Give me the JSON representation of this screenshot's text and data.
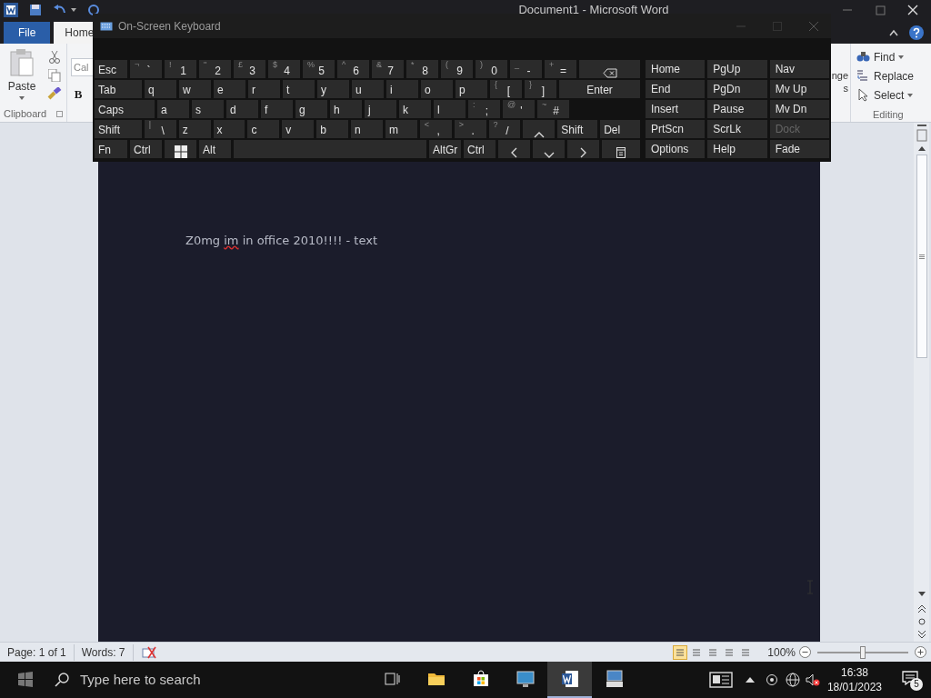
{
  "word_window": {
    "title": "Document1 - Microsoft Word",
    "ribbon_tabs": [
      {
        "label": "File",
        "kind": "file",
        "selected": false
      },
      {
        "label": "Home",
        "kind": "tab",
        "selected": true
      }
    ],
    "clipboard": {
      "paste": "Paste",
      "group": "Clipboard"
    },
    "font": {
      "font_box": "Cal",
      "bold": "B"
    },
    "styles_partial": [
      "nge",
      "s"
    ],
    "editing": {
      "items": [
        {
          "label": "Find",
          "dropdown": true,
          "kind": "find"
        },
        {
          "label": "Replace",
          "dropdown": false,
          "kind": "replace"
        },
        {
          "label": "Select",
          "dropdown": true,
          "kind": "select"
        }
      ],
      "group": "Editing"
    },
    "document": [
      {
        "text": "Z0mg",
        "misspelled": false
      },
      {
        "text": "im",
        "misspelled": true
      },
      {
        "text": "in office 2010!!!! - text",
        "misspelled": false
      }
    ],
    "status_bar": {
      "page": "Page: 1 of 1",
      "words": "Words: 7",
      "views": [
        {
          "selected": true
        },
        {
          "selected": false
        },
        {
          "selected": false
        },
        {
          "selected": false
        },
        {
          "selected": false
        }
      ],
      "zoom": "100%",
      "zoom_slider": {
        "level": 0.5
      }
    }
  },
  "keyboard": {
    "title": "On-Screen Keyboard",
    "rows": [
      [
        {
          "label": "Esc",
          "kind": "mod"
        },
        {
          "label": "`",
          "shift": "¬",
          "kind": "key"
        },
        {
          "label": "1",
          "shift": "!",
          "kind": "key"
        },
        {
          "label": "2",
          "shift": "\"",
          "kind": "key"
        },
        {
          "label": "3",
          "shift": "£",
          "kind": "key"
        },
        {
          "label": "4",
          "shift": "$",
          "kind": "key"
        },
        {
          "label": "5",
          "shift": "%",
          "kind": "key"
        },
        {
          "label": "6",
          "shift": "^",
          "kind": "key"
        },
        {
          "label": "7",
          "shift": "&",
          "kind": "key"
        },
        {
          "label": "8",
          "shift": "*",
          "kind": "key"
        },
        {
          "label": "9",
          "shift": "(",
          "kind": "key"
        },
        {
          "label": "0",
          "shift": ")",
          "kind": "key"
        },
        {
          "label": "-",
          "shift": "_",
          "kind": "key"
        },
        {
          "label": "=",
          "shift": "+",
          "kind": "key"
        },
        {
          "kind": "backspace"
        }
      ],
      [
        {
          "label": "Tab",
          "kind": "wide"
        },
        {
          "label": "q",
          "kind": "key"
        },
        {
          "label": "w",
          "kind": "key"
        },
        {
          "label": "e",
          "kind": "key"
        },
        {
          "label": "r",
          "kind": "key"
        },
        {
          "label": "t",
          "kind": "key"
        },
        {
          "label": "y",
          "kind": "key"
        },
        {
          "label": "u",
          "kind": "key"
        },
        {
          "label": "i",
          "kind": "key"
        },
        {
          "label": "o",
          "kind": "key"
        },
        {
          "label": "p",
          "kind": "key"
        },
        {
          "label": "[",
          "shift": "{",
          "kind": "key"
        },
        {
          "label": "]",
          "shift": "}",
          "kind": "key"
        },
        {
          "label": "Enter",
          "kind": "fill"
        }
      ],
      [
        {
          "label": "Caps",
          "kind": "caps"
        },
        {
          "label": "a",
          "kind": "key"
        },
        {
          "label": "s",
          "kind": "key"
        },
        {
          "label": "d",
          "kind": "key"
        },
        {
          "label": "f",
          "kind": "key"
        },
        {
          "label": "g",
          "kind": "key"
        },
        {
          "label": "h",
          "kind": "key"
        },
        {
          "label": "j",
          "kind": "key"
        },
        {
          "label": "k",
          "kind": "key"
        },
        {
          "label": "l",
          "kind": "key"
        },
        {
          "label": ";",
          "shift": ":",
          "kind": "key"
        },
        {
          "label": "'",
          "shift": "@",
          "kind": "key"
        },
        {
          "label": "#",
          "shift": "~",
          "kind": "key"
        }
      ],
      [
        {
          "label": "Shift",
          "kind": "wide"
        },
        {
          "label": "\\",
          "shift": "|",
          "kind": "key"
        },
        {
          "label": "z",
          "kind": "key"
        },
        {
          "label": "x",
          "kind": "key"
        },
        {
          "label": "c",
          "kind": "key"
        },
        {
          "label": "v",
          "kind": "key"
        },
        {
          "label": "b",
          "kind": "key"
        },
        {
          "label": "n",
          "kind": "key"
        },
        {
          "label": "m",
          "kind": "key"
        },
        {
          "label": ",",
          "shift": "<",
          "kind": "key"
        },
        {
          "label": ".",
          "shift": ">",
          "kind": "key"
        },
        {
          "label": "/",
          "shift": "?",
          "kind": "key"
        },
        {
          "kind": "up"
        },
        {
          "label": "Shift",
          "kind": "mid"
        },
        {
          "label": "Del",
          "kind": "mid"
        }
      ],
      [
        {
          "label": "Fn",
          "kind": "mod"
        },
        {
          "label": "Ctrl",
          "kind": "key"
        },
        {
          "kind": "windows"
        },
        {
          "label": "Alt",
          "kind": "key"
        },
        {
          "kind": "space"
        },
        {
          "label": "AltGr",
          "kind": "key"
        },
        {
          "label": "Ctrl",
          "kind": "key"
        },
        {
          "kind": "left"
        },
        {
          "kind": "down"
        },
        {
          "kind": "right"
        },
        {
          "kind": "menu"
        }
      ]
    ],
    "side_keys": [
      {
        "label": "Home",
        "disabled": false
      },
      {
        "label": "PgUp",
        "disabled": false
      },
      {
        "label": "Nav",
        "disabled": false
      },
      {
        "label": "End",
        "disabled": false
      },
      {
        "label": "PgDn",
        "disabled": false
      },
      {
        "label": "Mv Up",
        "disabled": false
      },
      {
        "label": "Insert",
        "disabled": false
      },
      {
        "label": "Pause",
        "disabled": false
      },
      {
        "label": "Mv Dn",
        "disabled": false
      },
      {
        "label": "PrtScn",
        "disabled": false
      },
      {
        "label": "ScrLk",
        "disabled": false
      },
      {
        "label": "Dock",
        "disabled": true
      },
      {
        "label": "Options",
        "disabled": false
      },
      {
        "label": "Help",
        "disabled": false
      },
      {
        "label": "Fade",
        "disabled": false
      }
    ]
  },
  "taskbar": {
    "search_placeholder": "Type here to search",
    "apps": [
      {
        "kind": "task-view",
        "selected": false
      },
      {
        "kind": "folder",
        "selected": false
      },
      {
        "kind": "store",
        "selected": false
      },
      {
        "kind": "monitor",
        "selected": false
      },
      {
        "kind": "word",
        "selected": true
      },
      {
        "kind": "keyboard",
        "selected": false
      }
    ],
    "time": "16:38",
    "date": "18/01/2023",
    "notifications": "5"
  }
}
